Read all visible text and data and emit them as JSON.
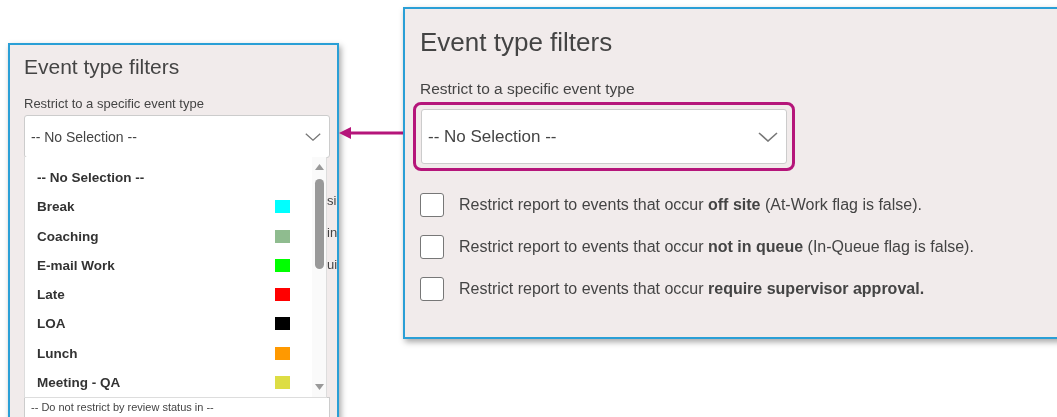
{
  "expanded_panel": {
    "title": "Event type filters",
    "field_label": "Restrict to a specific event type",
    "select": {
      "value": "-- No Selection --"
    },
    "options": [
      {
        "label": "-- No Selection --"
      },
      {
        "label": "Break",
        "color": "#00ffff"
      },
      {
        "label": "Coaching",
        "color": "#8fbc8f"
      },
      {
        "label": "E-mail Work",
        "color": "#00ff00"
      },
      {
        "label": "Late",
        "color": "#ff0000"
      },
      {
        "label": "LOA",
        "color": "#000000"
      },
      {
        "label": "Lunch",
        "color": "#ff9900"
      },
      {
        "label": "Meeting - QA",
        "color": "#dddd44"
      }
    ],
    "covered_row_fragments": [
      "si",
      "in",
      "ui"
    ],
    "bottom_select": {
      "value": "-- Do not restrict by review status in --"
    }
  },
  "zoomed_panel": {
    "title": "Event type filters",
    "field_label": "Restrict to a specific event type",
    "select": {
      "value": "-- No Selection --",
      "highlighted": true
    },
    "checkboxes": [
      {
        "label": "Restrict report to events that occur **off site** (At-Work flag is false).",
        "checked": false
      },
      {
        "label": "Restrict report to events that occur **not in queue** (In-Queue flag is false).",
        "checked": false
      },
      {
        "label": "Restrict report to events that occur **require supervisor approval.**",
        "checked": false
      }
    ]
  }
}
